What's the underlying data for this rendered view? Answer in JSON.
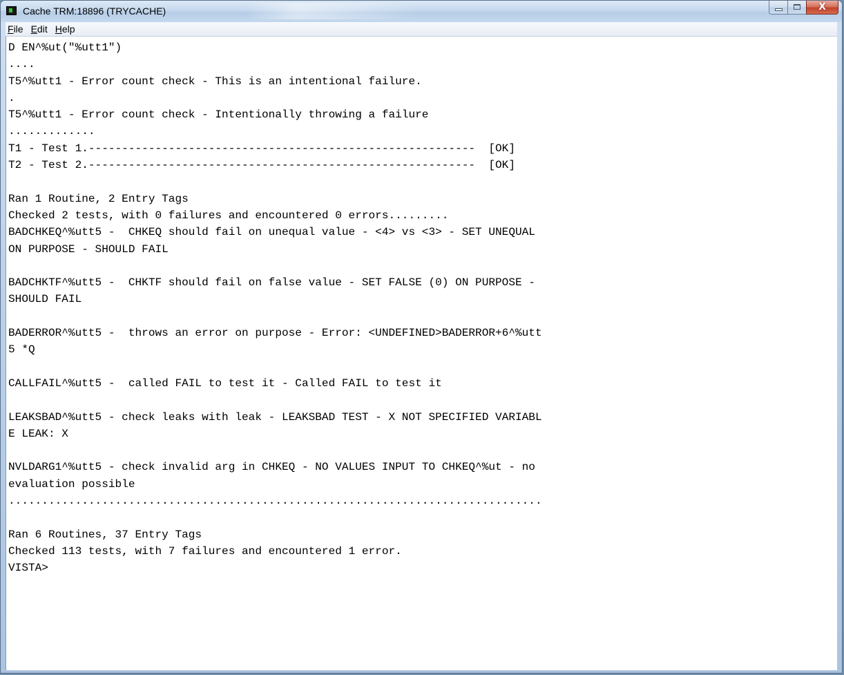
{
  "window": {
    "title": "Cache TRM:18896 (TRYCACHE)",
    "caption_buttons": {
      "minimize_icon": "minimize-icon",
      "maximize_icon": "maximize-icon",
      "close_glyph": "X"
    },
    "accent_color": "#c2432a"
  },
  "menubar": {
    "items": [
      {
        "label_ul": "F",
        "label_rest": "ile"
      },
      {
        "label_ul": "E",
        "label_rest": "dit"
      },
      {
        "label_ul": "H",
        "label_rest": "elp"
      }
    ]
  },
  "terminal": {
    "lines": [
      "D EN^%ut(\"%utt1\")",
      "....",
      "T5^%utt1 - Error count check - This is an intentional failure.",
      ".",
      "T5^%utt1 - Error count check - Intentionally throwing a failure",
      ".............",
      "T1 - Test 1.----------------------------------------------------------  [OK]",
      "T2 - Test 2.----------------------------------------------------------  [OK]",
      "",
      "Ran 1 Routine, 2 Entry Tags",
      "Checked 2 tests, with 0 failures and encountered 0 errors.........",
      "BADCHKEQ^%utt5 -  CHKEQ should fail on unequal value - <4> vs <3> - SET UNEQUAL",
      "ON PURPOSE - SHOULD FAIL",
      "",
      "BADCHKTF^%utt5 -  CHKTF should fail on false value - SET FALSE (0) ON PURPOSE -",
      "SHOULD FAIL",
      "",
      "BADERROR^%utt5 -  throws an error on purpose - Error: <UNDEFINED>BADERROR+6^%utt",
      "5 *Q",
      "",
      "CALLFAIL^%utt5 -  called FAIL to test it - Called FAIL to test it",
      "",
      "LEAKSBAD^%utt5 - check leaks with leak - LEAKSBAD TEST - X NOT SPECIFIED VARIABL",
      "E LEAK: X",
      "",
      "NVLDARG1^%utt5 - check invalid arg in CHKEQ - NO VALUES INPUT TO CHKEQ^%ut - no",
      "evaluation possible",
      "................................................................................",
      "",
      "Ran 6 Routines, 37 Entry Tags",
      "Checked 113 tests, with 7 failures and encountered 1 error.",
      "VISTA>"
    ]
  }
}
